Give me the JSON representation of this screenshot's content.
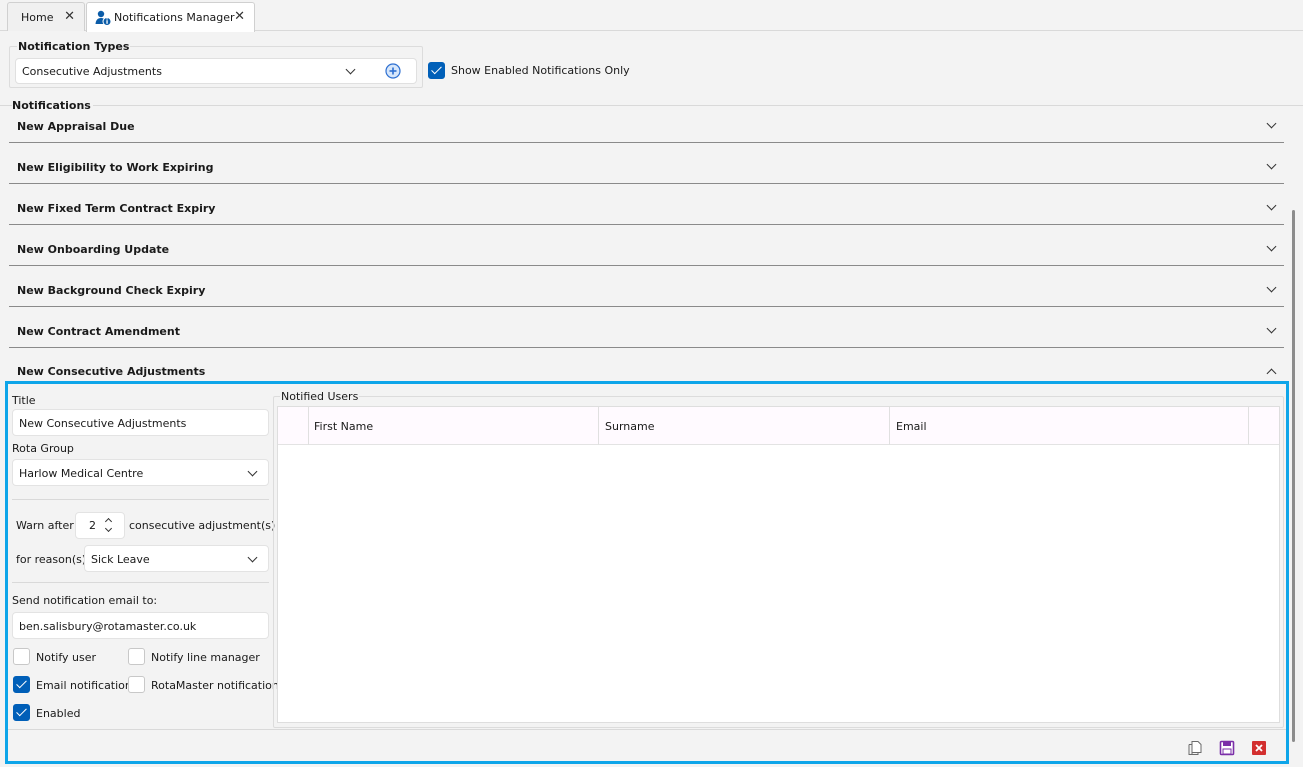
{
  "tabs": [
    {
      "label": "Home"
    },
    {
      "label": "Notifications Manager"
    }
  ],
  "notification_types": {
    "group_label": "Notification Types",
    "selected": "Consecutive Adjustments",
    "show_enabled_label": "Show Enabled Notifications Only",
    "show_enabled_checked": true
  },
  "notifications": {
    "section_label": "Notifications",
    "items": [
      {
        "title": "New Appraisal Due",
        "expanded": false
      },
      {
        "title": "New Eligibility to Work Expiring",
        "expanded": false
      },
      {
        "title": "New Fixed Term Contract Expiry",
        "expanded": false
      },
      {
        "title": "New Onboarding Update",
        "expanded": false
      },
      {
        "title": "New Background Check Expiry",
        "expanded": false
      },
      {
        "title": "New Contract Amendment",
        "expanded": false
      },
      {
        "title": "New Consecutive Adjustments",
        "expanded": true
      }
    ]
  },
  "detail": {
    "title_label": "Title",
    "title_value": "New Consecutive Adjustments",
    "rota_group_label": "Rota Group",
    "rota_group_value": "Harlow Medical Centre",
    "warn_after_label": "Warn after",
    "warn_after_value": "2",
    "consecutive_label": "consecutive adjustment(s)",
    "reason_label": "for reason(s)",
    "reason_value": "Sick Leave",
    "send_email_label": "Send notification email to:",
    "email_value": "ben.salisbury@rotamaster.co.uk",
    "checkboxes": {
      "notify_user": {
        "label": "Notify user",
        "checked": false
      },
      "notify_line_manager": {
        "label": "Notify line manager",
        "checked": false
      },
      "email_notification": {
        "label": "Email notification",
        "checked": true
      },
      "rotamaster_notification": {
        "label": "RotaMaster notification",
        "checked": false
      },
      "enabled": {
        "label": "Enabled",
        "checked": true
      }
    }
  },
  "notified_users": {
    "label": "Notified Users",
    "columns": [
      "First Name",
      "Surname",
      "Email"
    ],
    "rows": []
  },
  "colors": {
    "accent": "#005fb8",
    "highlight_border": "#0ea5e9",
    "save_icon": "#7b2fa8",
    "delete_icon": "#d32f2f"
  },
  "icons": {
    "add": "add-circle-icon",
    "copy": "copy-icon",
    "save": "save-icon",
    "delete": "delete-icon",
    "notifications_manager": "user-info-icon"
  }
}
